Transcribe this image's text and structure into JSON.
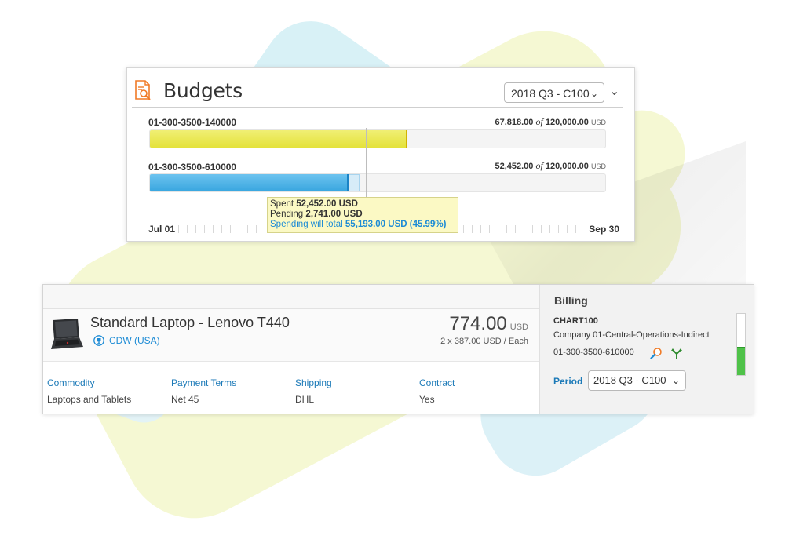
{
  "budgets": {
    "title": "Budgets",
    "period_select": "2018 Q3 - C100",
    "rows": [
      {
        "account": "01-300-3500-140000",
        "spent": "67,818.00",
        "of_label": "of",
        "total": "120,000.00",
        "currency": "USD",
        "fraction": 0.565,
        "color": "#e4e23a"
      },
      {
        "account": "01-300-3500-610000",
        "spent": "52,452.00",
        "of_label": "of",
        "total": "120,000.00",
        "currency": "USD",
        "fraction": 0.437,
        "pending_fraction": 0.023,
        "color": "#38a6df"
      }
    ],
    "timeline": {
      "start": "Jul 01",
      "end": "Sep 30"
    },
    "tooltip": {
      "spent_label": "Spent",
      "spent_value": "52,452.00 USD",
      "pending_label": "Pending",
      "pending_value": "2,741.00 USD",
      "total_label": "Spending will total",
      "total_value": "55,193.00 USD (45.99%)"
    }
  },
  "item": {
    "title": "Standard Laptop - Lenovo T440",
    "supplier": "CDW (USA)",
    "price": "774.00",
    "currency": "USD",
    "unit_price": "2 x 387.00 USD / Each",
    "attributes": [
      {
        "label": "Commodity",
        "value": "Laptops and Tablets"
      },
      {
        "label": "Payment Terms",
        "value": "Net 45"
      },
      {
        "label": "Shipping",
        "value": "DHL"
      },
      {
        "label": "Contract",
        "value": "Yes"
      }
    ]
  },
  "billing": {
    "title": "Billing",
    "chart": "CHART100",
    "company": "Company 01-Central-Operations-Indirect",
    "account": "01-300-3500-610000",
    "period_label": "Period",
    "period_value": "2018 Q3 - C100",
    "gauge_fraction": 0.46,
    "gauge_color": "#4fc249"
  },
  "colors": {
    "accent_blue": "#1c8bd5",
    "budget_icon": "#f07a26"
  },
  "icons": [
    "budget-document-icon",
    "laptop-image",
    "supplier-badge-icon",
    "magnifier-icon",
    "split-icon",
    "chevron-down-icon"
  ]
}
